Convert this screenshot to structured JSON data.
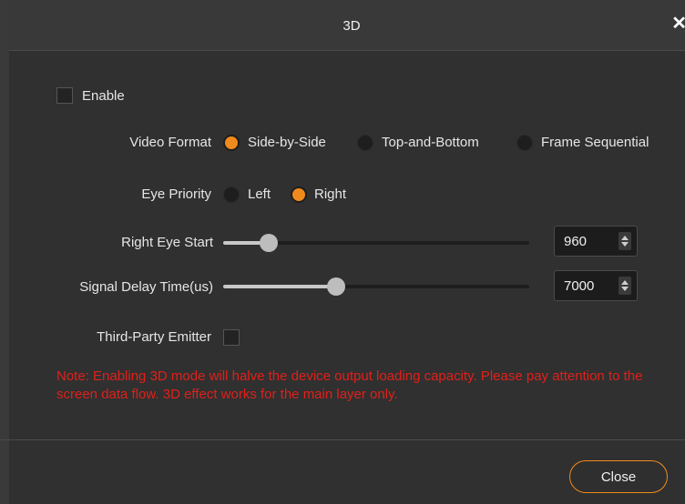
{
  "dialog": {
    "title": "3D",
    "close_icon": "close-icon",
    "close_label": "Close"
  },
  "enable": {
    "label": "Enable",
    "checked": false
  },
  "video_format": {
    "label": "Video Format",
    "options": [
      "Side-by-Side",
      "Top-and-Bottom",
      "Frame Sequential"
    ],
    "selected": "Side-by-Side"
  },
  "eye_priority": {
    "label": "Eye Priority",
    "options": [
      "Left",
      "Right"
    ],
    "selected": "Right"
  },
  "right_eye_start": {
    "label": "Right Eye Start",
    "value": "960"
  },
  "signal_delay": {
    "label": "Signal Delay Time(us)",
    "value": "7000"
  },
  "third_party": {
    "label": "Third-Party Emitter",
    "checked": false
  },
  "note": "Note: Enabling 3D mode will halve the device output loading capacity. Please pay attention to the screen data flow. 3D effect works for the main layer only.",
  "colors": {
    "accent": "#f08a1c",
    "note": "#e0201a",
    "background": "#303030"
  }
}
